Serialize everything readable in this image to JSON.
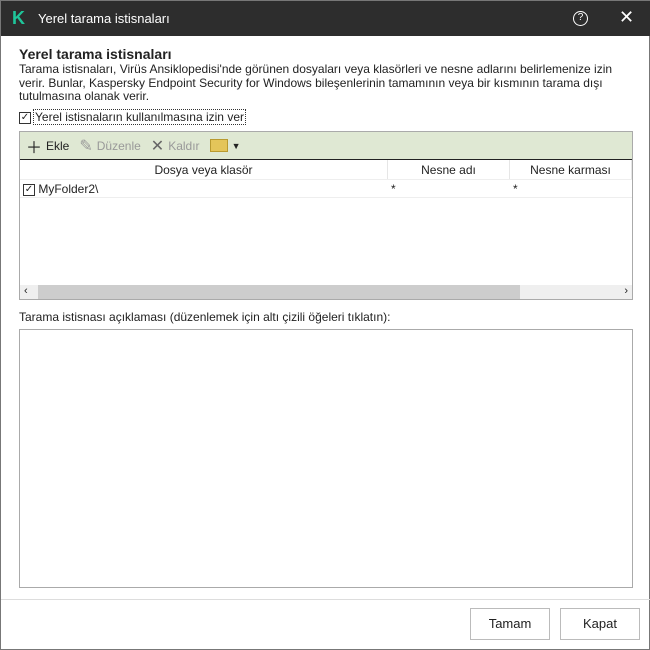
{
  "window": {
    "title": "Yerel tarama istisnaları",
    "logo": "K"
  },
  "heading": "Yerel tarama istisnaları",
  "description": "Tarama istisnaları, Virüs Ansiklopedisi'nde görünen dosyaları veya klasörleri ve nesne adlarını belirlemenize izin verir. Bunlar, Kaspersky Endpoint Security for Windows bileşenlerinin tamamının veya bir kısmının tarama dışı tutulmasına olanak verir.",
  "allow_checkbox": {
    "label": "Yerel istisnaların kullanılmasına izin ver",
    "checked": true
  },
  "toolbar": {
    "add": "Ekle",
    "edit": "Düzenle",
    "remove": "Kaldır"
  },
  "table": {
    "columns": [
      "Dosya veya klasör",
      "Nesne adı",
      "Nesne karması"
    ],
    "rows": [
      {
        "path": "MyFolder2\\",
        "name": "*",
        "hash": "*",
        "checked": true
      }
    ]
  },
  "description_label": "Tarama istisnası açıklaması (düzenlemek için altı çizili öğeleri tıklatın):",
  "buttons": {
    "ok": "Tamam",
    "close": "Kapat"
  }
}
